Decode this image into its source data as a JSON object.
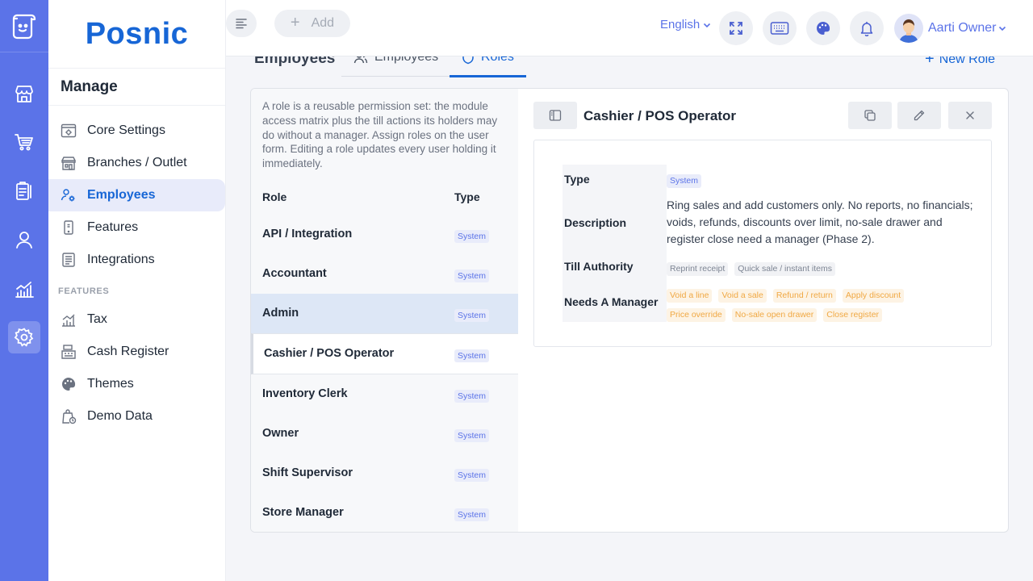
{
  "app": {
    "brand": "Posnic"
  },
  "rail": {
    "items": [
      "logo",
      "store",
      "cart",
      "clipboard",
      "user",
      "reports",
      "settings"
    ],
    "active": "settings"
  },
  "menu": {
    "title": "Manage",
    "items": [
      {
        "label": "Core Settings"
      },
      {
        "label": "Branches / Outlet"
      },
      {
        "label": "Employees"
      },
      {
        "label": "Features"
      },
      {
        "label": "Integrations"
      }
    ],
    "section_label": "FEATURES",
    "feature_items": [
      {
        "label": "Tax"
      },
      {
        "label": "Cash Register"
      },
      {
        "label": "Themes"
      },
      {
        "label": "Demo Data"
      }
    ]
  },
  "topbar": {
    "add_label": "Add",
    "language": "English",
    "user_name": "Aarti Owner"
  },
  "page": {
    "title": "Employees",
    "tabs": [
      {
        "label": "Employees"
      },
      {
        "label": "Roles"
      }
    ],
    "new_role_label": "New Role"
  },
  "roles_panel": {
    "intro": "A role is a reusable permission set: the module access matrix plus the till actions its holders may do without a manager. Assign roles on the user form. Editing a role updates every user holding it immediately.",
    "col_role": "Role",
    "col_type": "Type",
    "rows": [
      {
        "name": "API / Integration",
        "type": "System"
      },
      {
        "name": "Accountant",
        "type": "System"
      },
      {
        "name": "Admin",
        "type": "System"
      },
      {
        "name": "Cashier / POS Operator",
        "type": "System"
      },
      {
        "name": "Inventory Clerk",
        "type": "System"
      },
      {
        "name": "Owner",
        "type": "System"
      },
      {
        "name": "Shift Supervisor",
        "type": "System"
      },
      {
        "name": "Store Manager",
        "type": "System"
      }
    ]
  },
  "detail": {
    "title": "Cashier / POS Operator",
    "type_label": "Type",
    "type_value": "System",
    "description_label": "Description",
    "description_value": "Ring sales and add customers only. No reports, no financials; voids, refunds, discounts over limit, no-sale drawer and register close need a manager (Phase 2).",
    "till_label": "Till Authority",
    "till_items": [
      "Reprint receipt",
      "Quick sale / instant items"
    ],
    "manager_label": "Needs A Manager",
    "manager_items": [
      "Void a line",
      "Void a sale",
      "Refund / return",
      "Apply discount",
      "Price override",
      "No-sale open drawer",
      "Close register"
    ]
  },
  "colors": {
    "rail": "#5b73e8",
    "brand": "#1766d6",
    "orange_chip": "#f0a843"
  }
}
